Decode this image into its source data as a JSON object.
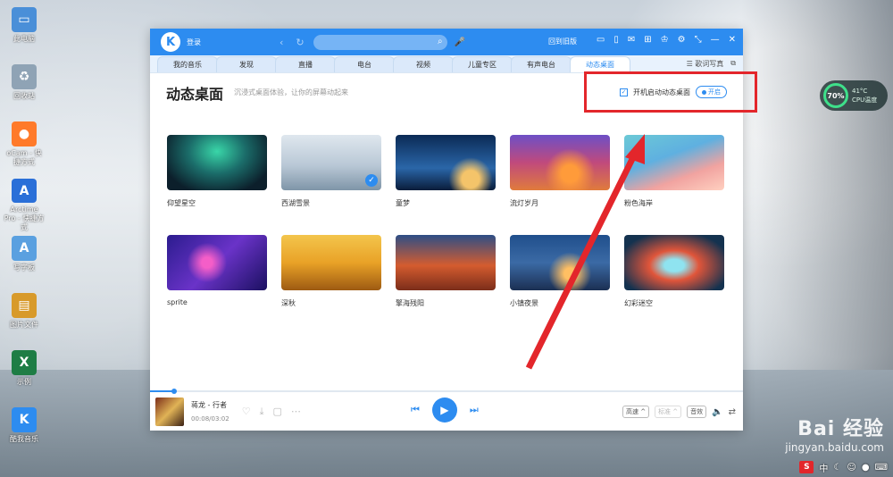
{
  "desktop": {
    "icons": [
      {
        "label": "此电脑",
        "icon": "computer-icon",
        "color": "#4a8fd8"
      },
      {
        "label": "回收站",
        "icon": "recycle-bin-icon",
        "color": "#8fa3b5"
      },
      {
        "label": "oCam - 快捷方式",
        "icon": "ocam-icon",
        "color": "#ff7a2a"
      },
      {
        "label": "Arctime Pro - 快捷方式",
        "icon": "arctime-icon",
        "color": "#2a6fd8"
      },
      {
        "label": "写字板",
        "icon": "wordpad-icon",
        "color": "#5aa0e0"
      },
      {
        "label": "图片文件",
        "icon": "folder-icon",
        "color": "#d89a2a"
      },
      {
        "label": "示例",
        "icon": "excel-icon",
        "color": "#1e7d45"
      },
      {
        "label": "酷我音乐",
        "icon": "kuwo-icon",
        "color": "#2d8cf0"
      }
    ]
  },
  "app": {
    "logo": "K",
    "login": "登录",
    "back_to_old": "回到旧版",
    "tabs": [
      {
        "label": "我的音乐"
      },
      {
        "label": "发现"
      },
      {
        "label": "直播"
      },
      {
        "label": "电台"
      },
      {
        "label": "视频"
      },
      {
        "label": "儿童专区"
      },
      {
        "label": "有声电台"
      },
      {
        "label": "动态桌面",
        "active": true
      }
    ],
    "tab_right": [
      "☰ 歌词写真",
      "⧉"
    ],
    "page_title": "动态桌面",
    "page_subtitle": "沉浸式桌面体验，让你的屏幕动起来",
    "autostart_label": "开机启动动态桌面",
    "autostart_checked": "✓",
    "on_button": "开启",
    "wallpapers": [
      {
        "name": "仰望星空",
        "selected": false
      },
      {
        "name": "西湖雪景",
        "selected": true
      },
      {
        "name": "童梦",
        "selected": false
      },
      {
        "name": "流灯岁月",
        "selected": false
      },
      {
        "name": "粉色海岸",
        "selected": false
      },
      {
        "name": "sprite",
        "selected": false
      },
      {
        "name": "深秋",
        "selected": false
      },
      {
        "name": "擎海残阳",
        "selected": false
      },
      {
        "name": "小镇夜景",
        "selected": false
      },
      {
        "name": "幻彩迷空",
        "selected": false
      }
    ],
    "player": {
      "song": "蒋龙 - 行者",
      "time": "00:08/03:02",
      "progress": 0.04,
      "quality": "高速 ^",
      "standard": "标准 ^",
      "effect": "音效"
    }
  },
  "cpu": {
    "percent": "70%",
    "temp": "41°C",
    "label": "CPU温度"
  },
  "watermark": {
    "big": "Bai 经验",
    "small": "jingyan.baidu.com"
  },
  "tray": {
    "ime": "S",
    "lang": "中"
  },
  "accent": "#2d8cf0",
  "annotation_color": "#e3262b"
}
